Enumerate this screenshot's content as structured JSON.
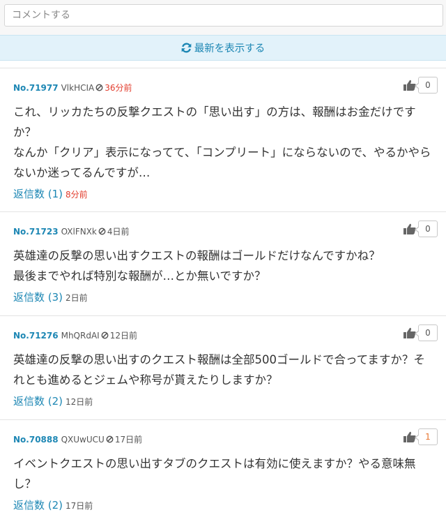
{
  "comment": {
    "placeholder": "コメントする"
  },
  "refresh": {
    "label": "最新を表示する"
  },
  "colors": {
    "link": "#1d87b4",
    "new_time": "#e23c2c",
    "like_active": "#e8752f"
  },
  "posts": [
    {
      "no": "No.71977",
      "user_id": "VlkHCIA",
      "time": "36分前",
      "likes": "0",
      "body": "これ、リッカたちの反撃クエストの「思い出す」の方は、報酬はお金だけですか？\nなんか「クリア」表示になってて、「コンプリート」にならないので、やるかやらないか迷ってるんですが…",
      "reply_label": "返信数 (1)",
      "reply_time": "8分前"
    },
    {
      "no": "No.71723",
      "user_id": "OXlFNXk",
      "time": "4日前",
      "likes": "0",
      "body": "英雄達の反撃の思い出すクエストの報酬はゴールドだけなんですかね？\n最後までやれば特別な報酬が…とか無いですか？",
      "reply_label": "返信数 (3)",
      "reply_time": "2日前"
    },
    {
      "no": "No.71276",
      "user_id": "MhQRdAI",
      "time": "12日前",
      "likes": "0",
      "body": "英雄達の反撃の思い出すのクエスト報酬は全部500ゴールドで合ってますか？それとも進めるとジェムや称号が貰えたりしますか？",
      "reply_label": "返信数 (2)",
      "reply_time": "12日前"
    },
    {
      "no": "No.70888",
      "user_id": "QXUwUCU",
      "time": "17日前",
      "likes": "1",
      "body": "イベントクエストの思い出すタブのクエストは有効に使えますか？やる意味無し？",
      "reply_label": "返信数 (2)",
      "reply_time": "17日前"
    }
  ]
}
